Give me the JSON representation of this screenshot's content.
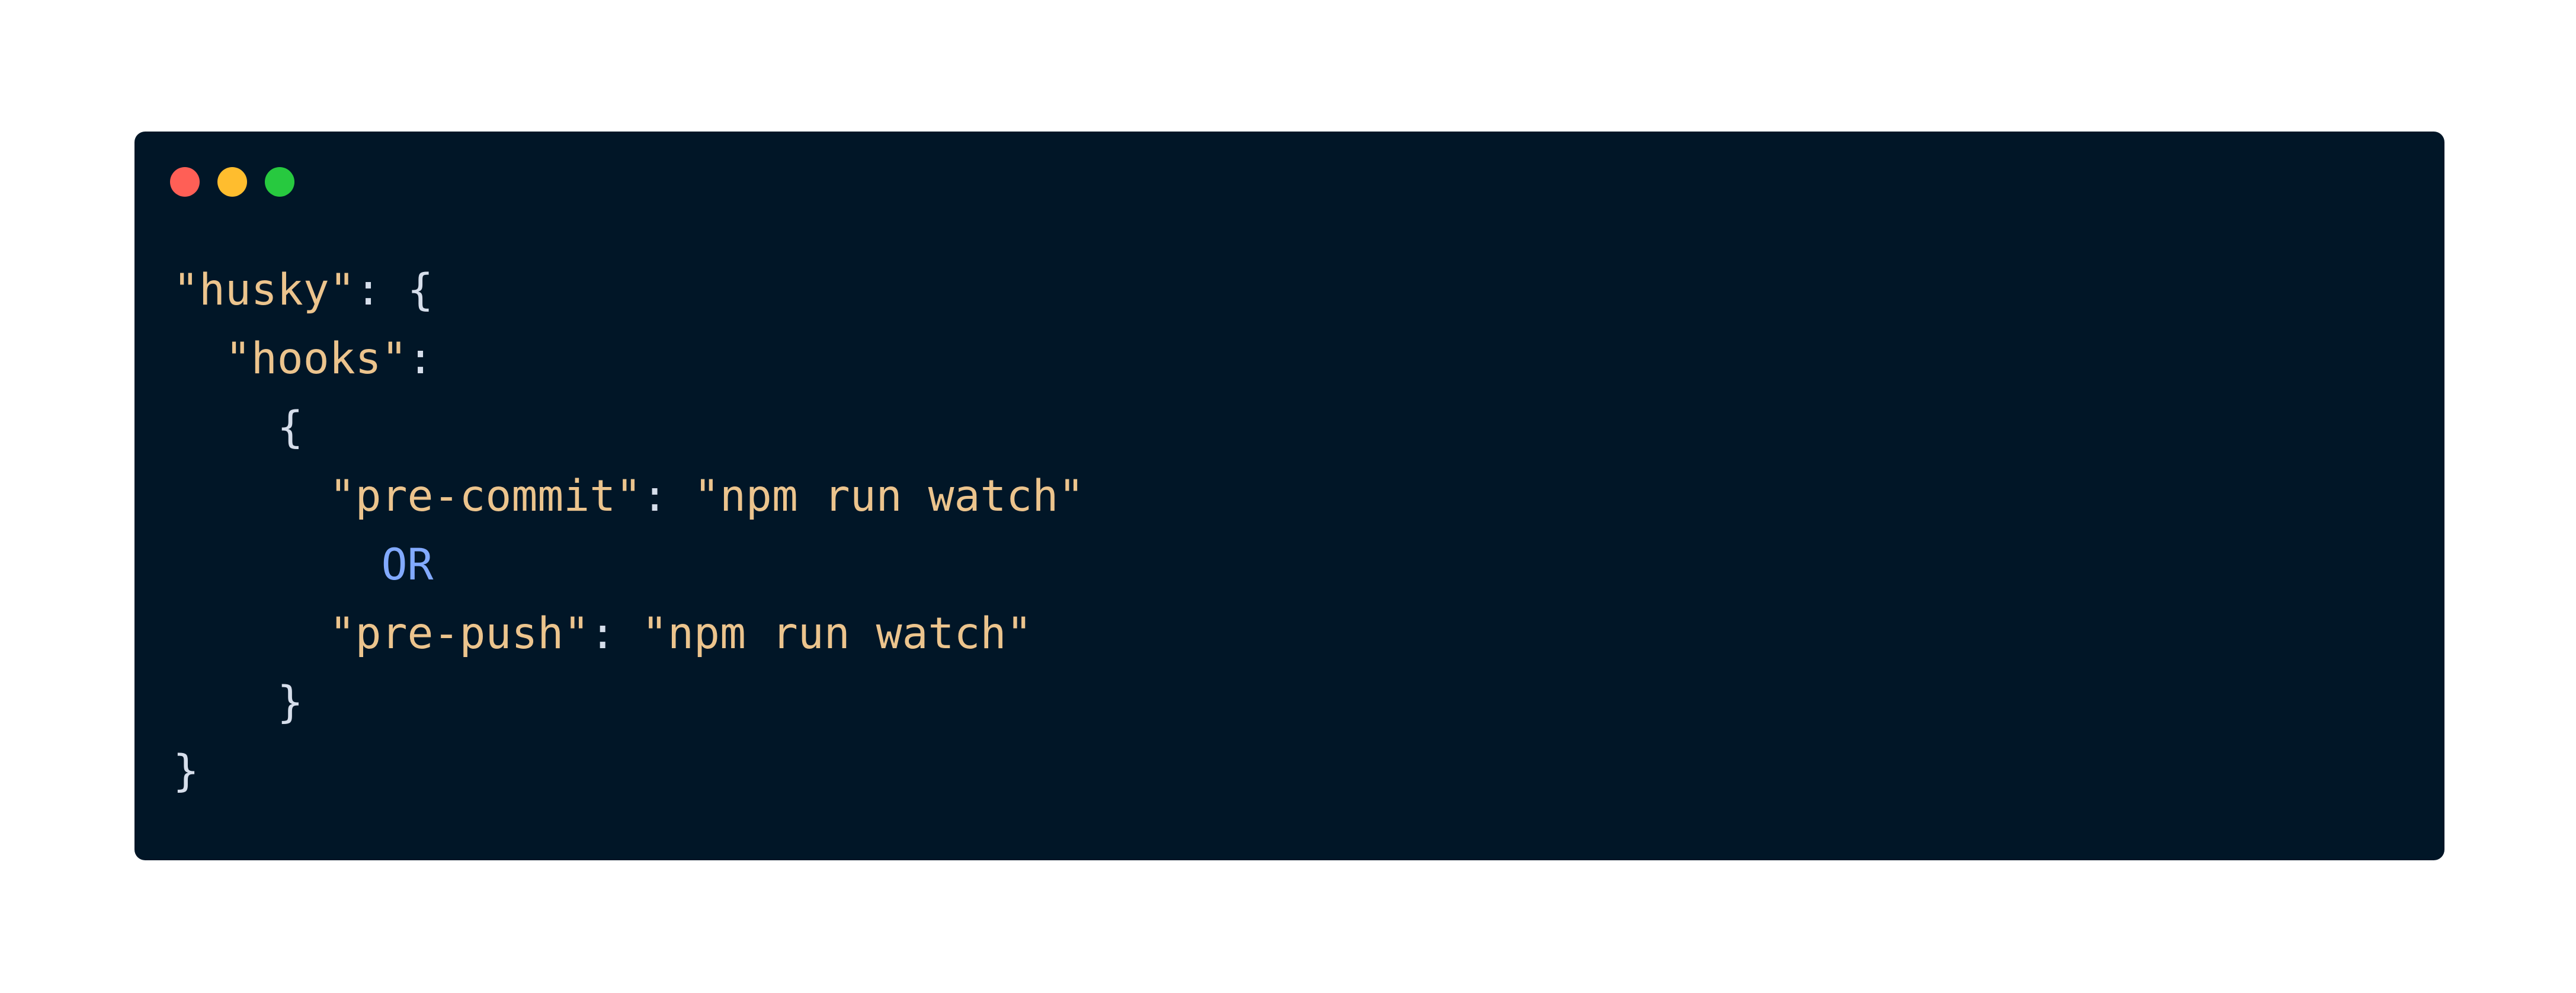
{
  "window": {
    "background": "#011627",
    "controls": [
      {
        "name": "close",
        "color": "#ff5f56"
      },
      {
        "name": "minimize",
        "color": "#ffbd2e"
      },
      {
        "name": "maximize",
        "color": "#27c93f"
      }
    ]
  },
  "colors": {
    "string": "#ecc48d",
    "punctuation": "#d6deeb",
    "keyword": "#82aaff"
  },
  "code": {
    "lines": [
      {
        "indent": "",
        "tokens": [
          {
            "text": "\"husky\"",
            "type": "string"
          },
          {
            "text": ": {",
            "type": "punct"
          }
        ]
      },
      {
        "indent": "  ",
        "tokens": [
          {
            "text": "\"hooks\"",
            "type": "string"
          },
          {
            "text": ":",
            "type": "punct"
          }
        ]
      },
      {
        "indent": "    ",
        "tokens": [
          {
            "text": "{",
            "type": "punct"
          }
        ]
      },
      {
        "indent": "      ",
        "tokens": [
          {
            "text": "\"pre-commit\"",
            "type": "string"
          },
          {
            "text": ": ",
            "type": "punct"
          },
          {
            "text": "\"npm run watch\"",
            "type": "string"
          }
        ]
      },
      {
        "indent": "        ",
        "tokens": [
          {
            "text": "OR",
            "type": "keyword"
          }
        ]
      },
      {
        "indent": "      ",
        "tokens": [
          {
            "text": "\"pre-push\"",
            "type": "string"
          },
          {
            "text": ": ",
            "type": "punct"
          },
          {
            "text": "\"npm run watch\"",
            "type": "string"
          }
        ]
      },
      {
        "indent": "    ",
        "tokens": [
          {
            "text": "}",
            "type": "punct"
          }
        ]
      },
      {
        "indent": "",
        "tokens": [
          {
            "text": "}",
            "type": "punct"
          }
        ]
      }
    ]
  }
}
